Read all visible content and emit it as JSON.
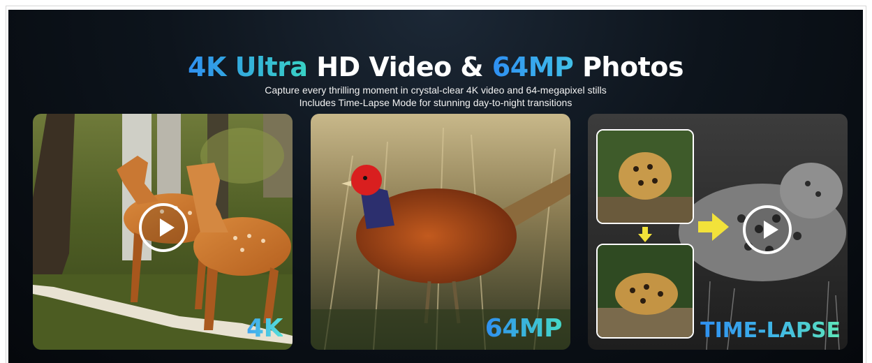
{
  "headline": {
    "part1": "4K Ultra",
    "part2": " HD Video & ",
    "part3": "64MP",
    "part4": " Photos"
  },
  "subtitle": {
    "line1": "Capture every thrilling moment in crystal-clear 4K video and 64-megapixel stills",
    "line2": "Includes Time-Lapse Mode for stunning day-to-night transitions"
  },
  "panels": [
    {
      "label": "4K",
      "subject": "deer-in-forest",
      "has_play": true
    },
    {
      "label": "64MP",
      "subject": "pheasant-in-grass",
      "has_play": false
    },
    {
      "label": "TIME-LAPSE",
      "subject": "jaguar-day-to-night",
      "has_play": true
    }
  ],
  "colors": {
    "background": "#0d141c",
    "accent_blue": "#2f8ff0",
    "accent_teal": "#39d2c4",
    "arrow_yellow": "#f2e23a",
    "text": "#ffffff"
  },
  "icons": [
    "play-icon",
    "arrow-right-icon",
    "arrow-down-icon"
  ]
}
